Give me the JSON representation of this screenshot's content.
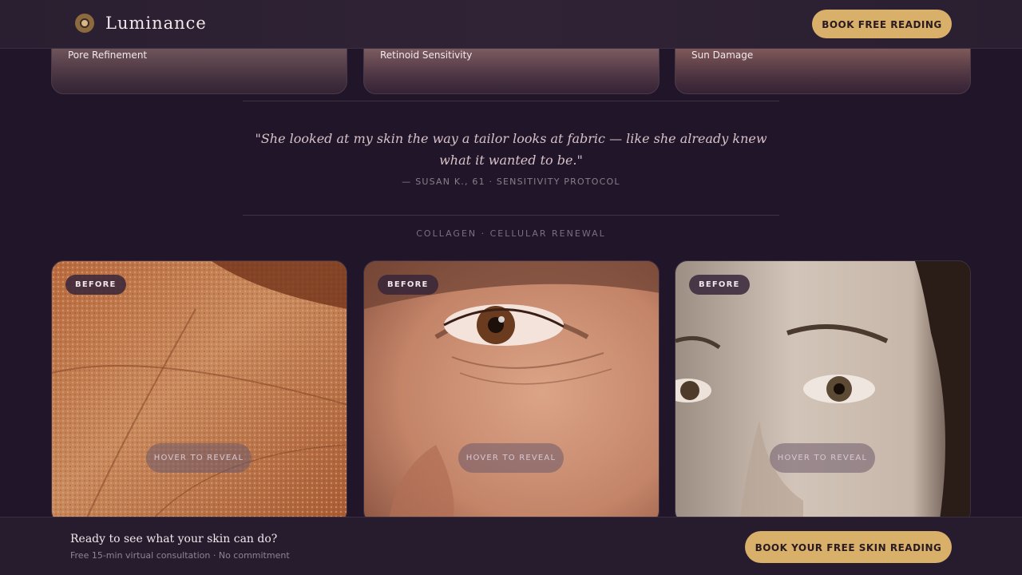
{
  "header": {
    "brand_name": "Luminance",
    "cta_label": "BOOK FREE READING"
  },
  "top_cards": [
    {
      "label": "Pore Refinement"
    },
    {
      "label": "Retinoid Sensitivity"
    },
    {
      "label": "Sun Damage"
    }
  ],
  "testimonial": {
    "quote": "\"She looked at my skin the way a tailor looks at fabric — like she already knew what it wanted to be.\"",
    "attribution": "— SUSAN K., 61 · SENSITIVITY PROTOCOL"
  },
  "section": {
    "label": "COLLAGEN · CELLULAR RENEWAL"
  },
  "cards": [
    {
      "badge": "BEFORE",
      "hover_label": "HOVER TO REVEAL",
      "image": "skin-texture-closeup"
    },
    {
      "badge": "BEFORE",
      "hover_label": "HOVER TO REVEAL",
      "image": "mature-eye-closeup"
    },
    {
      "badge": "BEFORE",
      "hover_label": "HOVER TO REVEAL",
      "image": "woman-face-closeup"
    }
  ],
  "cta_bar": {
    "title": "Ready to see what your skin can do?",
    "subtitle": "Free 15-min virtual consultation · No commitment",
    "button_label": "BOOK YOUR FREE SKIN READING"
  },
  "colors": {
    "background": "#211629",
    "accent_gold": "#d8b06a",
    "card_border": "#3c2f42"
  }
}
